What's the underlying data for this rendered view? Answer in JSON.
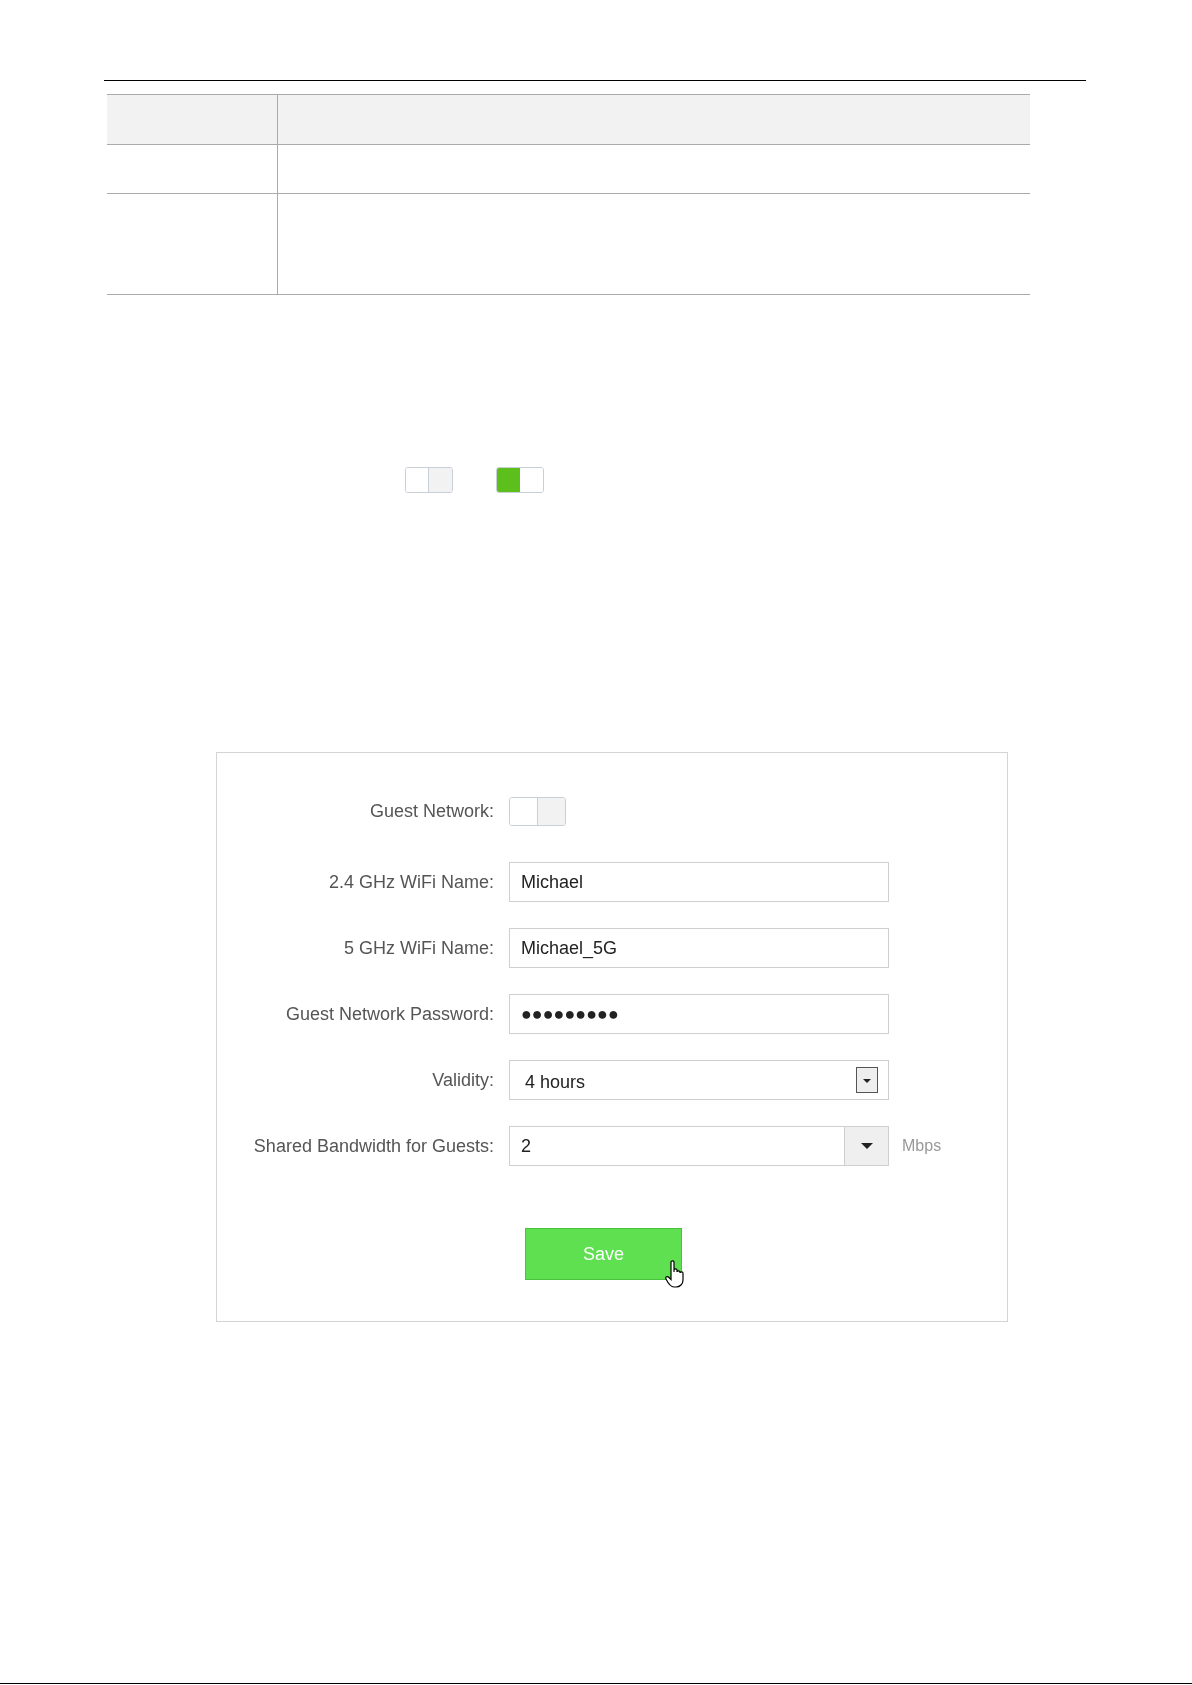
{
  "table": {
    "rows": [
      {
        "kind": "header"
      },
      {
        "kind": "body"
      },
      {
        "kind": "body"
      }
    ]
  },
  "toggle_examples": [
    {
      "on": false
    },
    {
      "on": true
    }
  ],
  "guest_form": {
    "rows": [
      {
        "kind": "toggle",
        "label": "Guest Network:",
        "on": false
      },
      {
        "kind": "text",
        "label": "2.4 GHz WiFi Name:",
        "value": "Michael"
      },
      {
        "kind": "text",
        "label": "5 GHz WiFi Name:",
        "value": "Michael_5G"
      },
      {
        "kind": "password",
        "label": "Guest Network Password:",
        "value": "●●●●●●●●●"
      },
      {
        "kind": "select",
        "label": "Validity:",
        "value": "4 hours"
      },
      {
        "kind": "combo",
        "label": "Shared Bandwidth for Guests:",
        "value": "2",
        "unit": "Mbps"
      }
    ],
    "save_button": "Save"
  }
}
